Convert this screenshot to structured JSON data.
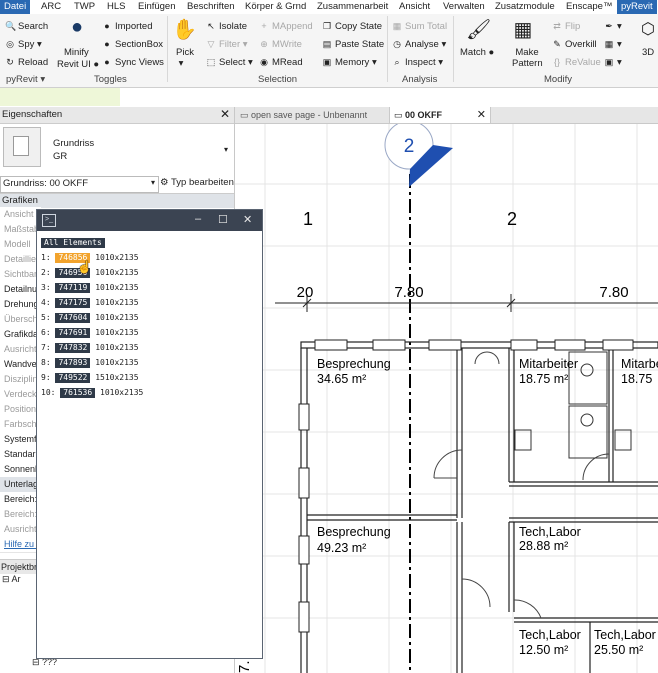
{
  "menu": {
    "tabs": [
      "Datei",
      "ARC",
      "TWP",
      "HLS",
      "Einfügen",
      "Beschriften",
      "Körper & Grnd",
      "Zusammenarbeit",
      "Ansicht",
      "Verwalten",
      "Zusatzmodule",
      "Enscape™",
      "pyRevit"
    ]
  },
  "ribbon": {
    "pyrevit": {
      "search": "Search",
      "spy": "Spy",
      "reload": "Reload",
      "minify": "Minify",
      "revit_ui": "Revit UI",
      "group": "pyRevit"
    },
    "toggles": {
      "imported": "Imported",
      "section_box": "SectionBox",
      "sync_views": "Sync Views",
      "group": "Toggles"
    },
    "selection": {
      "pick": "Pick",
      "isolate": "Isolate",
      "filter": "Filter",
      "select": "Select",
      "mappend": "MAppend",
      "mwrite": "MWrite",
      "mread": "MRead",
      "copy_state": "Copy State",
      "paste_state": "Paste State",
      "memory": "Memory",
      "group": "Selection"
    },
    "analysis": {
      "sum_total": "Sum Total",
      "analyse": "Analyse",
      "inspect": "Inspect",
      "group": "Analysis"
    },
    "modify": {
      "match": "Match",
      "make_pattern": "Make Pattern",
      "flip": "Flip",
      "overkill": "Overkill",
      "revalue": "ReValue",
      "group": "Modify",
      "three_d": "3D"
    }
  },
  "properties": {
    "title": "Eigenschaften",
    "type_name": "Grundriss",
    "type_sub": "GR",
    "instance": "Grundriss: 00 OKFF",
    "edit_type": "Typ bearbeiten",
    "category": "Grafiken",
    "rows": [
      "Ansicht",
      "Maßstab",
      "Modell",
      "Detaillie",
      "Sichtbar",
      "Detailnu",
      "Drehung",
      "Übersch",
      "Grafikda",
      "Ausricht",
      "Wandve",
      "Disziplin",
      "Verdeck",
      "Position",
      "Farbsch",
      "Systemf",
      "Standar",
      "Sonnenl",
      "Unterlage",
      "Bereich:",
      "Bereich:",
      "Ausricht",
      "Hilfe zu E"
    ],
    "browser_title": "Projektbr",
    "browser_item": "???"
  },
  "doc_tabs": [
    {
      "label": "open save page - Unbenannt"
    },
    {
      "label": "00 OKFF"
    }
  ],
  "console": {
    "header": "All Elements",
    "rows": [
      {
        "n": "1:",
        "id": "746856",
        "dim": "1010x2135"
      },
      {
        "n": "2:",
        "id": "746956",
        "dim": "1010x2135"
      },
      {
        "n": "3:",
        "id": "747119",
        "dim": "1010x2135"
      },
      {
        "n": "4:",
        "id": "747175",
        "dim": "1010x2135"
      },
      {
        "n": "5:",
        "id": "747604",
        "dim": "1010x2135"
      },
      {
        "n": "6:",
        "id": "747691",
        "dim": "1010x2135"
      },
      {
        "n": "7:",
        "id": "747832",
        "dim": "1010x2135"
      },
      {
        "n": "8:",
        "id": "747893",
        "dim": "1010x2135"
      },
      {
        "n": "9:",
        "id": "749522",
        "dim": "1510x2135"
      },
      {
        "n": "10:",
        "id": "761536",
        "dim": "1010x2135"
      }
    ]
  },
  "plan": {
    "section_marker": "2",
    "grid_1": "1",
    "grid_2": "2",
    "dim_left": "20",
    "dim_a": "7.80",
    "dim_b": "7.80",
    "dim_side": "7.",
    "rooms": [
      {
        "name": "Besprechung",
        "area": "34.65 m²"
      },
      {
        "name": "Mitarbeiter",
        "area": "18.75 m²"
      },
      {
        "name": "Mitarbe",
        "area": "18.75"
      },
      {
        "name": "Besprechung",
        "area": "49.23 m²"
      },
      {
        "name": "Tech,Labor",
        "area": "28.88 m²"
      },
      {
        "name": "Tech,Labor",
        "area": "12.50 m²"
      },
      {
        "name": "Tech,Labor",
        "area": "25.50 m²"
      }
    ]
  },
  "colors": {
    "accent": "#2a69b3",
    "highlight": "#f2a32c",
    "chip": "#2f3a48",
    "console_bar": "#3b4452",
    "marker": "#1f4fb0"
  }
}
